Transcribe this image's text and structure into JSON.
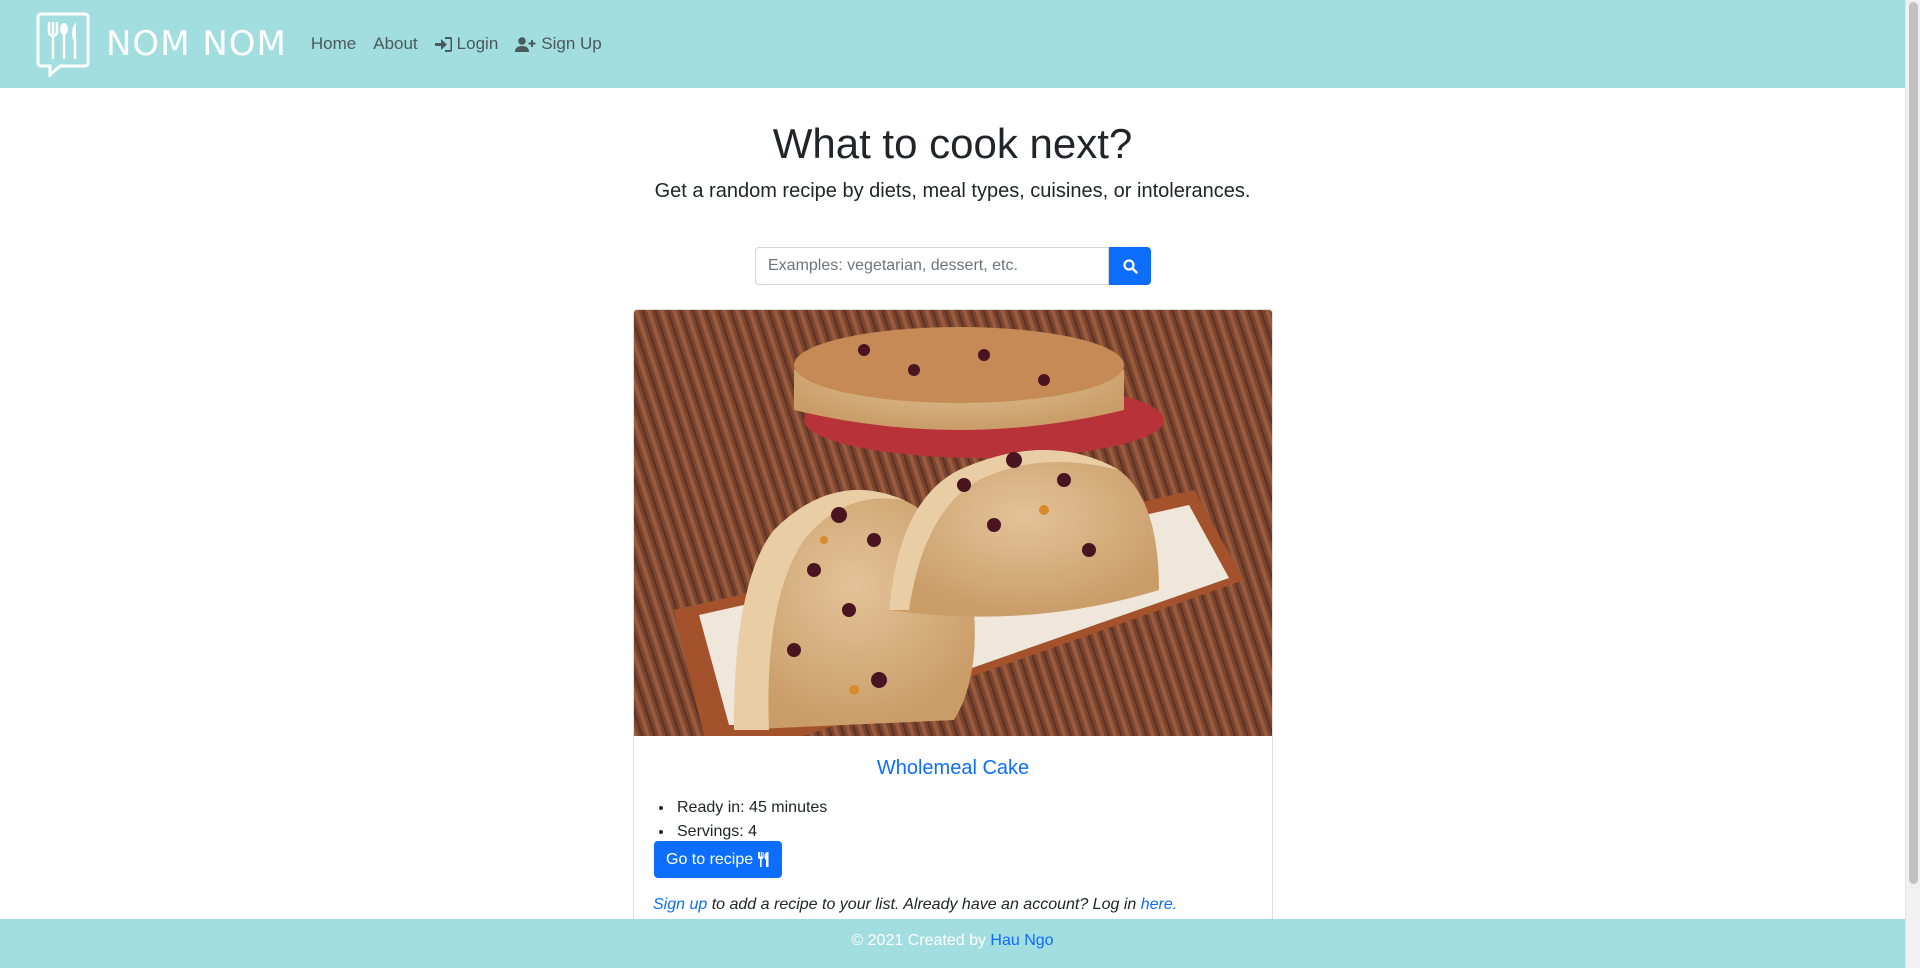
{
  "brand": {
    "name": "NOM NOM",
    "logo_icon": "fork-spoon-knife-logo-icon"
  },
  "nav": {
    "home": "Home",
    "about": "About",
    "login": "Login",
    "signup": "Sign Up"
  },
  "hero": {
    "title": "What to cook next?",
    "subtitle": "Get a random recipe by diets, meal types, cuisines, or intolerances."
  },
  "search": {
    "placeholder": "Examples: vegetarian, dessert, etc.",
    "value": "",
    "button_icon": "search-icon"
  },
  "recipe": {
    "title": "Wholemeal Cake",
    "ready_in": "Ready in: 45 minutes",
    "servings": "Servings: 4",
    "go_button": "Go to recipe",
    "note_signup": "Sign up",
    "note_middle": " to add a recipe to your list. Already have an account? Log in ",
    "note_here": "here."
  },
  "footer": {
    "text": "© 2021 Created by ",
    "author": "Hau Ngo"
  },
  "colors": {
    "navbar_bg": "#a2dddf",
    "primary": "#0d6efd"
  }
}
